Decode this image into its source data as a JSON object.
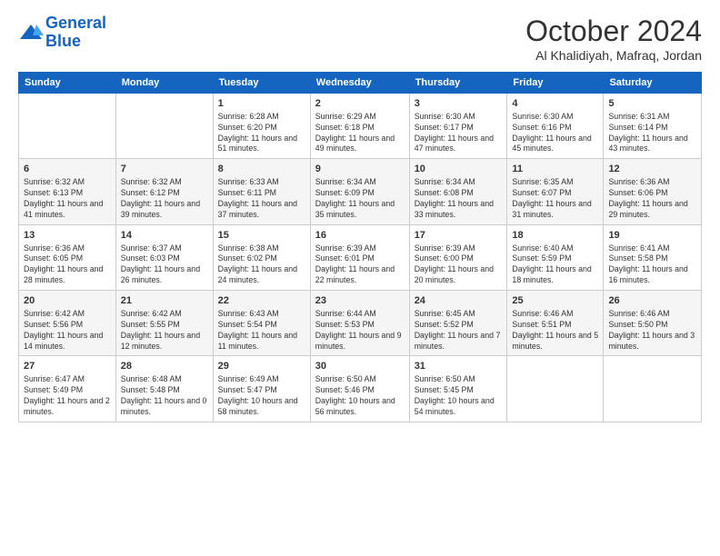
{
  "logo": {
    "line1": "General",
    "line2": "Blue"
  },
  "title": "October 2024",
  "location": "Al Khalidiyah, Mafraq, Jordan",
  "days_of_week": [
    "Sunday",
    "Monday",
    "Tuesday",
    "Wednesday",
    "Thursday",
    "Friday",
    "Saturday"
  ],
  "weeks": [
    [
      {
        "day": "",
        "info": ""
      },
      {
        "day": "",
        "info": ""
      },
      {
        "day": "1",
        "info": "Sunrise: 6:28 AM\nSunset: 6:20 PM\nDaylight: 11 hours and 51 minutes."
      },
      {
        "day": "2",
        "info": "Sunrise: 6:29 AM\nSunset: 6:18 PM\nDaylight: 11 hours and 49 minutes."
      },
      {
        "day": "3",
        "info": "Sunrise: 6:30 AM\nSunset: 6:17 PM\nDaylight: 11 hours and 47 minutes."
      },
      {
        "day": "4",
        "info": "Sunrise: 6:30 AM\nSunset: 6:16 PM\nDaylight: 11 hours and 45 minutes."
      },
      {
        "day": "5",
        "info": "Sunrise: 6:31 AM\nSunset: 6:14 PM\nDaylight: 11 hours and 43 minutes."
      }
    ],
    [
      {
        "day": "6",
        "info": "Sunrise: 6:32 AM\nSunset: 6:13 PM\nDaylight: 11 hours and 41 minutes."
      },
      {
        "day": "7",
        "info": "Sunrise: 6:32 AM\nSunset: 6:12 PM\nDaylight: 11 hours and 39 minutes."
      },
      {
        "day": "8",
        "info": "Sunrise: 6:33 AM\nSunset: 6:11 PM\nDaylight: 11 hours and 37 minutes."
      },
      {
        "day": "9",
        "info": "Sunrise: 6:34 AM\nSunset: 6:09 PM\nDaylight: 11 hours and 35 minutes."
      },
      {
        "day": "10",
        "info": "Sunrise: 6:34 AM\nSunset: 6:08 PM\nDaylight: 11 hours and 33 minutes."
      },
      {
        "day": "11",
        "info": "Sunrise: 6:35 AM\nSunset: 6:07 PM\nDaylight: 11 hours and 31 minutes."
      },
      {
        "day": "12",
        "info": "Sunrise: 6:36 AM\nSunset: 6:06 PM\nDaylight: 11 hours and 29 minutes."
      }
    ],
    [
      {
        "day": "13",
        "info": "Sunrise: 6:36 AM\nSunset: 6:05 PM\nDaylight: 11 hours and 28 minutes."
      },
      {
        "day": "14",
        "info": "Sunrise: 6:37 AM\nSunset: 6:03 PM\nDaylight: 11 hours and 26 minutes."
      },
      {
        "day": "15",
        "info": "Sunrise: 6:38 AM\nSunset: 6:02 PM\nDaylight: 11 hours and 24 minutes."
      },
      {
        "day": "16",
        "info": "Sunrise: 6:39 AM\nSunset: 6:01 PM\nDaylight: 11 hours and 22 minutes."
      },
      {
        "day": "17",
        "info": "Sunrise: 6:39 AM\nSunset: 6:00 PM\nDaylight: 11 hours and 20 minutes."
      },
      {
        "day": "18",
        "info": "Sunrise: 6:40 AM\nSunset: 5:59 PM\nDaylight: 11 hours and 18 minutes."
      },
      {
        "day": "19",
        "info": "Sunrise: 6:41 AM\nSunset: 5:58 PM\nDaylight: 11 hours and 16 minutes."
      }
    ],
    [
      {
        "day": "20",
        "info": "Sunrise: 6:42 AM\nSunset: 5:56 PM\nDaylight: 11 hours and 14 minutes."
      },
      {
        "day": "21",
        "info": "Sunrise: 6:42 AM\nSunset: 5:55 PM\nDaylight: 11 hours and 12 minutes."
      },
      {
        "day": "22",
        "info": "Sunrise: 6:43 AM\nSunset: 5:54 PM\nDaylight: 11 hours and 11 minutes."
      },
      {
        "day": "23",
        "info": "Sunrise: 6:44 AM\nSunset: 5:53 PM\nDaylight: 11 hours and 9 minutes."
      },
      {
        "day": "24",
        "info": "Sunrise: 6:45 AM\nSunset: 5:52 PM\nDaylight: 11 hours and 7 minutes."
      },
      {
        "day": "25",
        "info": "Sunrise: 6:46 AM\nSunset: 5:51 PM\nDaylight: 11 hours and 5 minutes."
      },
      {
        "day": "26",
        "info": "Sunrise: 6:46 AM\nSunset: 5:50 PM\nDaylight: 11 hours and 3 minutes."
      }
    ],
    [
      {
        "day": "27",
        "info": "Sunrise: 6:47 AM\nSunset: 5:49 PM\nDaylight: 11 hours and 2 minutes."
      },
      {
        "day": "28",
        "info": "Sunrise: 6:48 AM\nSunset: 5:48 PM\nDaylight: 11 hours and 0 minutes."
      },
      {
        "day": "29",
        "info": "Sunrise: 6:49 AM\nSunset: 5:47 PM\nDaylight: 10 hours and 58 minutes."
      },
      {
        "day": "30",
        "info": "Sunrise: 6:50 AM\nSunset: 5:46 PM\nDaylight: 10 hours and 56 minutes."
      },
      {
        "day": "31",
        "info": "Sunrise: 6:50 AM\nSunset: 5:45 PM\nDaylight: 10 hours and 54 minutes."
      },
      {
        "day": "",
        "info": ""
      },
      {
        "day": "",
        "info": ""
      }
    ]
  ]
}
